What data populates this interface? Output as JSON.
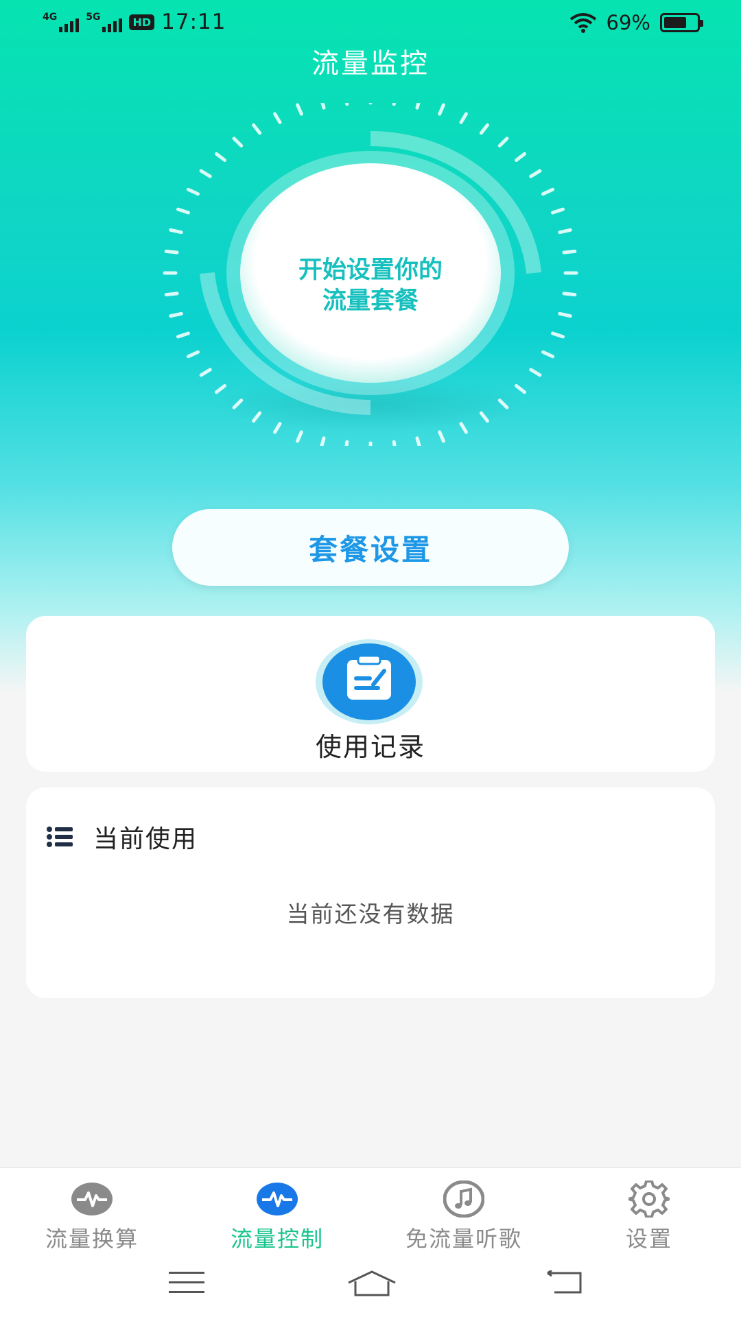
{
  "status_bar": {
    "net1": "4G",
    "net2": "5G",
    "hd": "HD",
    "time": "17:11",
    "battery": "69%"
  },
  "header": {
    "title": "流量监控"
  },
  "dial": {
    "text_line1": "开始设置你的",
    "text_line2": "流量套餐"
  },
  "plan_button": {
    "label": "套餐设置"
  },
  "records": {
    "label": "使用记录",
    "icon": "clipboard-icon"
  },
  "current_usage": {
    "title": "当前使用",
    "icon": "list-icon",
    "empty_text": "当前还没有数据"
  },
  "bottom_nav": {
    "items": [
      {
        "label": "流量换算",
        "icon": "pulse-icon",
        "active": false
      },
      {
        "label": "流量控制",
        "icon": "pulse-icon",
        "active": true
      },
      {
        "label": "免流量听歌",
        "icon": "music-icon",
        "active": false
      },
      {
        "label": "设置",
        "icon": "gear-icon",
        "active": false
      }
    ]
  },
  "colors": {
    "accent": "#18c48c",
    "button_text": "#1d97e6",
    "dial_text": "#16c0be"
  }
}
